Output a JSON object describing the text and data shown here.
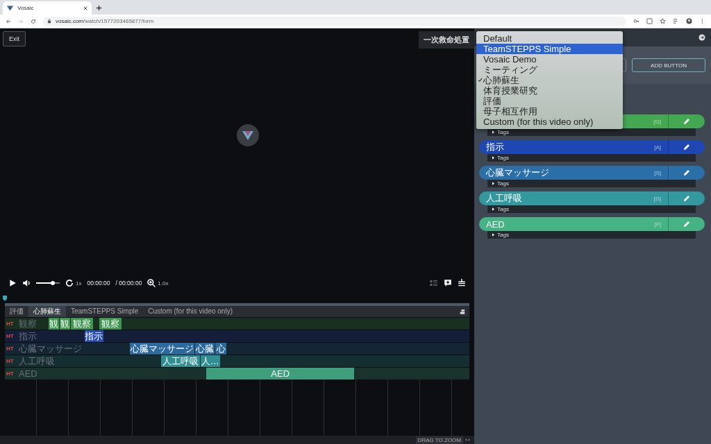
{
  "browser": {
    "tab_title": "Vosaic",
    "url_host": "vosaic.com",
    "url_path": "/watch/1577203465877/form"
  },
  "video": {
    "exit_label": "Exit",
    "title": "一次救命処置",
    "volume": {
      "level": 0.7
    },
    "speed": "1x",
    "time": "00:00:00",
    "duration": "/ 00:00:00",
    "zoom": "1.0x"
  },
  "timeline": {
    "tabs": [
      {
        "label": "評価",
        "selected": false
      },
      {
        "label": "心肺蘇生",
        "selected": true
      },
      {
        "label": "TeamSTEPPS Simple",
        "selected": false
      },
      {
        "label": "Custom (for this video only)",
        "selected": false
      }
    ],
    "tracks": [
      {
        "badge": "HT",
        "name": "観察",
        "color": "#3f9650",
        "clips": [
          "観",
          "観",
          "観察",
          "観察"
        ]
      },
      {
        "badge": "HT",
        "name": "指示",
        "color": "#2a4fb0",
        "clips": [
          "指示"
        ]
      },
      {
        "badge": "HT",
        "name": "心臓マッサージ",
        "color": "#2c6a9e",
        "clips": [
          "心臓マッサージ",
          "心臓",
          "心"
        ]
      },
      {
        "badge": "HT",
        "name": "人工呼吸",
        "color": "#2f8f92",
        "clips": [
          "人工呼吸",
          "人…"
        ]
      },
      {
        "badge": "HT",
        "name": "AED",
        "color": "#3f9e7c",
        "clips": [
          "AED"
        ]
      }
    ],
    "zoom_hint": "DRAG TO ZOOM"
  },
  "panel": {
    "add_button": "ADD BUTTON",
    "buttons": [
      {
        "key": "[G]",
        "color": "#43a851",
        "tags": "Tags"
      },
      {
        "label": "指示",
        "key": "[A]",
        "color": "#1f47b4",
        "tags": "Tags"
      },
      {
        "label": "心臓マッサージ",
        "key": "[S]",
        "color": "#2b6fa8",
        "tags": "Tags"
      },
      {
        "label": "人工呼吸",
        "key": "[D]",
        "color": "#33999f",
        "tags": "Tags"
      },
      {
        "label": "AED",
        "key": "[F]",
        "color": "#45b383",
        "tags": "Tags"
      }
    ]
  },
  "dropdown": {
    "options": [
      {
        "label": "Default",
        "selected": false,
        "checked": false
      },
      {
        "label": "TeamSTEPPS Simple",
        "selected": true,
        "checked": false
      },
      {
        "label": "Vosaic Demo",
        "selected": false,
        "checked": false
      },
      {
        "label": "ミーティング",
        "selected": false,
        "checked": false
      },
      {
        "label": "心肺蘇生",
        "selected": false,
        "checked": true
      },
      {
        "label": "体育授業研究",
        "selected": false,
        "checked": false
      },
      {
        "label": "評価",
        "selected": false,
        "checked": false
      },
      {
        "label": "母子相互作用",
        "selected": false,
        "checked": false
      },
      {
        "label": "Custom (for this video only)",
        "selected": false,
        "checked": false
      }
    ]
  }
}
